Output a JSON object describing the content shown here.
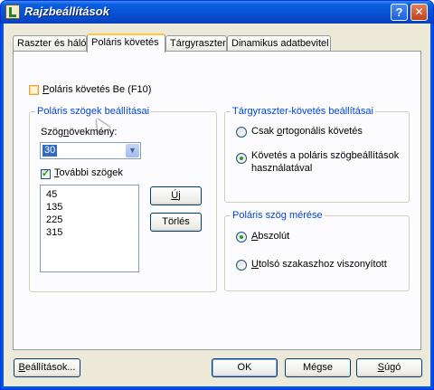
{
  "window": {
    "title": "Rajzbeállítások",
    "help_glyph": "?",
    "close_glyph": "✕"
  },
  "tabs": [
    {
      "label": "Raszter és háló"
    },
    {
      "label": "Poláris követés",
      "active": true
    },
    {
      "label": "Tárgyraszter"
    },
    {
      "label": "Dinamikus adatbevitel"
    }
  ],
  "polar": {
    "enable_label_before": "",
    "enable_label_under": "P",
    "enable_label_after": "oláris követés Be (F10)",
    "enable_checked": false
  },
  "angle_settings": {
    "legend": "Poláris szögek beállításai",
    "increment_label_before": "Szög",
    "increment_label_under": "n",
    "increment_label_after": "övekmény:",
    "increment_value": "30",
    "additional_before": "",
    "additional_under": "T",
    "additional_after": "ovábbi szögek",
    "additional_checked": true,
    "angles": [
      "45",
      "135",
      "225",
      "315"
    ],
    "new_button_under": "Ú",
    "new_button_after": "j",
    "delete_button": "Törlés"
  },
  "object_snap": {
    "legend": "Tárgyraszter-követés beállításai",
    "orthogonal_before": "Csak ",
    "orthogonal_under": "o",
    "orthogonal_after": "rtogonális követés",
    "all_polar_line1": "Követés a poláris szögbeállítások",
    "all_polar_line2": "használatával",
    "selected": "all_polar"
  },
  "measurement": {
    "legend": "Poláris szög mérése",
    "absolute_under": "A",
    "absolute_after": "bszolút",
    "relative_under": "U",
    "relative_after": "tolsó szakaszhoz viszonyított",
    "selected": "absolute"
  },
  "footer": {
    "options_under": "B",
    "options_after": "eállítások...",
    "ok": "OK",
    "cancel": "Mégse",
    "help_under": "S",
    "help_after": "úgó"
  },
  "colors": {
    "title_blue": "#0853d6",
    "group_legend": "#0046d5",
    "selection": "#316ac5",
    "check_green": "#21a121"
  }
}
